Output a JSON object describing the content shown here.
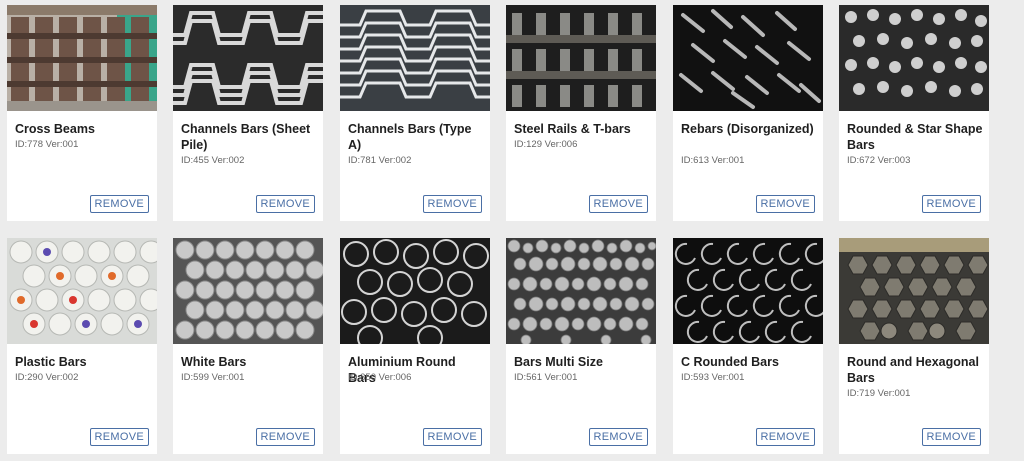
{
  "remove_label": "REMOVE",
  "items": [
    {
      "title": "Cross Beams",
      "meta": "ID:778 Ver:001",
      "image": "steel-cross-beams-image"
    },
    {
      "title": "Channels Bars (Sheet Pile)",
      "meta": "ID:455 Ver:002",
      "image": "channel-bars-sheet-pile-image"
    },
    {
      "title": "Channels Bars (Type A)",
      "meta": "ID:781 Ver:002",
      "image": "channel-bars-type-a-image"
    },
    {
      "title": "Steel Rails & T-bars",
      "meta": "ID:129 Ver:006",
      "image": "steel-rails-image"
    },
    {
      "title": "Rebars (Disorganized)",
      "meta": "ID:613 Ver:001",
      "image": "rebars-image"
    },
    {
      "title": "Rounded & Star Shape Bars",
      "meta": "ID:672 Ver:003",
      "image": "star-shape-bars-image"
    },
    {
      "title": "Plastic Bars",
      "meta": "ID:290 Ver:002",
      "image": "plastic-bars-image"
    },
    {
      "title": "White Bars",
      "meta": "ID:599 Ver:001",
      "image": "white-bars-image"
    },
    {
      "title": "Aluminium Round Bars",
      "meta": "ID:350 Ver:006",
      "image": "aluminium-round-bars-image"
    },
    {
      "title": "Bars Multi Size",
      "meta": "ID:561 Ver:001",
      "image": "multi-size-bars-image"
    },
    {
      "title": "C Rounded Bars",
      "meta": "ID:593 Ver:001",
      "image": "c-rounded-bars-image"
    },
    {
      "title": "Round and Hexagonal Bars",
      "meta": "ID:719 Ver:001",
      "image": "hexagonal-bars-image"
    }
  ]
}
